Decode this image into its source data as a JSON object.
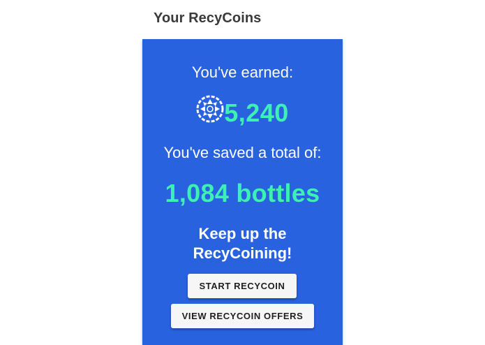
{
  "header": {
    "title": "Your RecyCoins"
  },
  "summary": {
    "earned_label": "You've earned:",
    "coin_icon": "recycoin-logo-icon",
    "coins": "5,240",
    "saved_label": "You've saved a total of:",
    "bottles": "1,084 bottles",
    "encouragement_line1": "Keep up the",
    "encouragement_line2": "RecyCoining!"
  },
  "actions": {
    "start_label": "START RECYCOIN",
    "offers_label": "VIEW RECYCOIN OFFERS"
  },
  "colors": {
    "panel_background": "#2862de",
    "accent_green": "#3ef0b4",
    "button_background": "#f6f6f6"
  }
}
